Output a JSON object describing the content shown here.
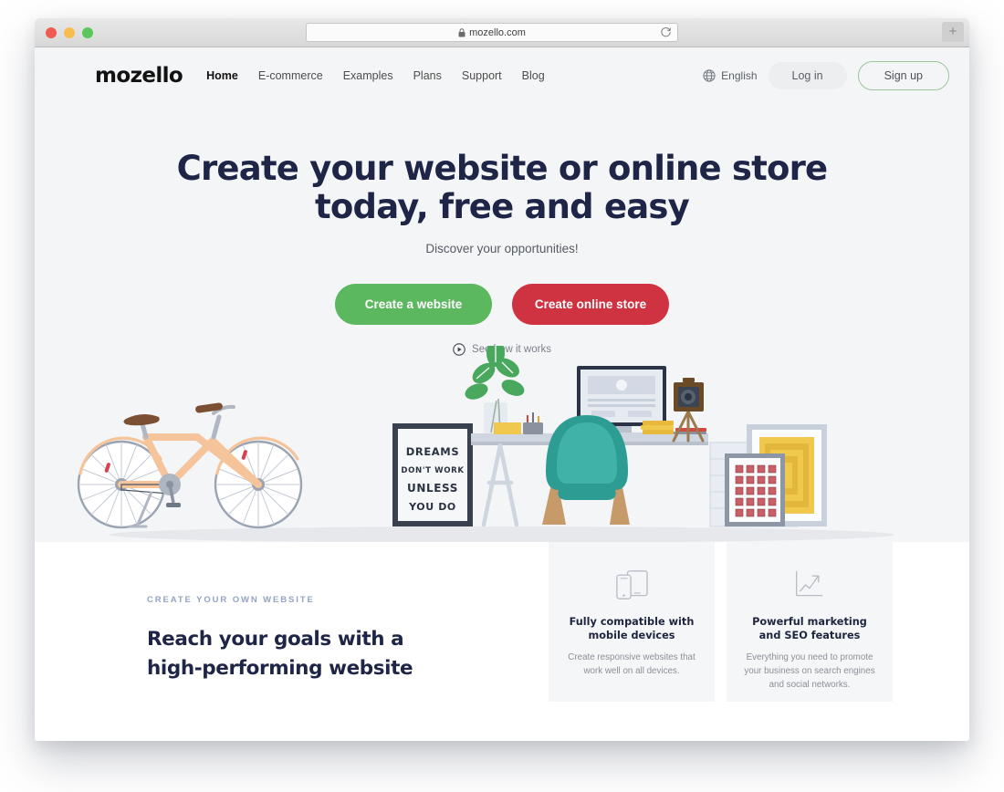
{
  "browser": {
    "url": "mozello.com",
    "lock_icon": "lock-icon",
    "reload_icon": "reload-icon",
    "new_tab_label": "+",
    "traffic_lights": [
      "close-red",
      "minimize-yellow",
      "maximize-green"
    ]
  },
  "header": {
    "logo": "mozello",
    "nav": [
      {
        "label": "Home",
        "active": true
      },
      {
        "label": "E-commerce",
        "active": false
      },
      {
        "label": "Examples",
        "active": false
      },
      {
        "label": "Plans",
        "active": false
      },
      {
        "label": "Support",
        "active": false
      },
      {
        "label": "Blog",
        "active": false
      }
    ],
    "language": {
      "icon": "globe-icon",
      "label": "English"
    },
    "login_label": "Log in",
    "signup_label": "Sign up"
  },
  "hero": {
    "title_line1": "Create your website or online store",
    "title_line2": "today, free and easy",
    "subtitle": "Discover your opportunities!",
    "cta_primary": "Create a website",
    "cta_secondary": "Create online store",
    "video_link": "See how it works",
    "video_icon": "play-circle-icon",
    "poster_text": {
      "line1": "DREAMS",
      "line2": "DON'T WORK",
      "line3": "UNLESS",
      "line4": "YOU DO"
    }
  },
  "features_section": {
    "eyebrow": "CREATE YOUR OWN WEBSITE",
    "title_line1": "Reach your goals with a",
    "title_line2": "high-performing website",
    "cards": [
      {
        "icon": "mobile-devices-icon",
        "title": "Fully compatible with mobile devices",
        "description": "Create responsive websites that work well on all devices."
      },
      {
        "icon": "growth-chart-icon",
        "title": "Powerful marketing and SEO features",
        "description": "Everything you need to promote your business on search engines and social networks."
      }
    ]
  },
  "colors": {
    "hero_background": "#f4f5f7",
    "headline": "#1f2546",
    "cta_green": "#5cb85f",
    "cta_red": "#cf3341",
    "signup_border": "#9dc49d",
    "eyebrow": "#93a3c4",
    "card_background": "#f5f6f8"
  }
}
